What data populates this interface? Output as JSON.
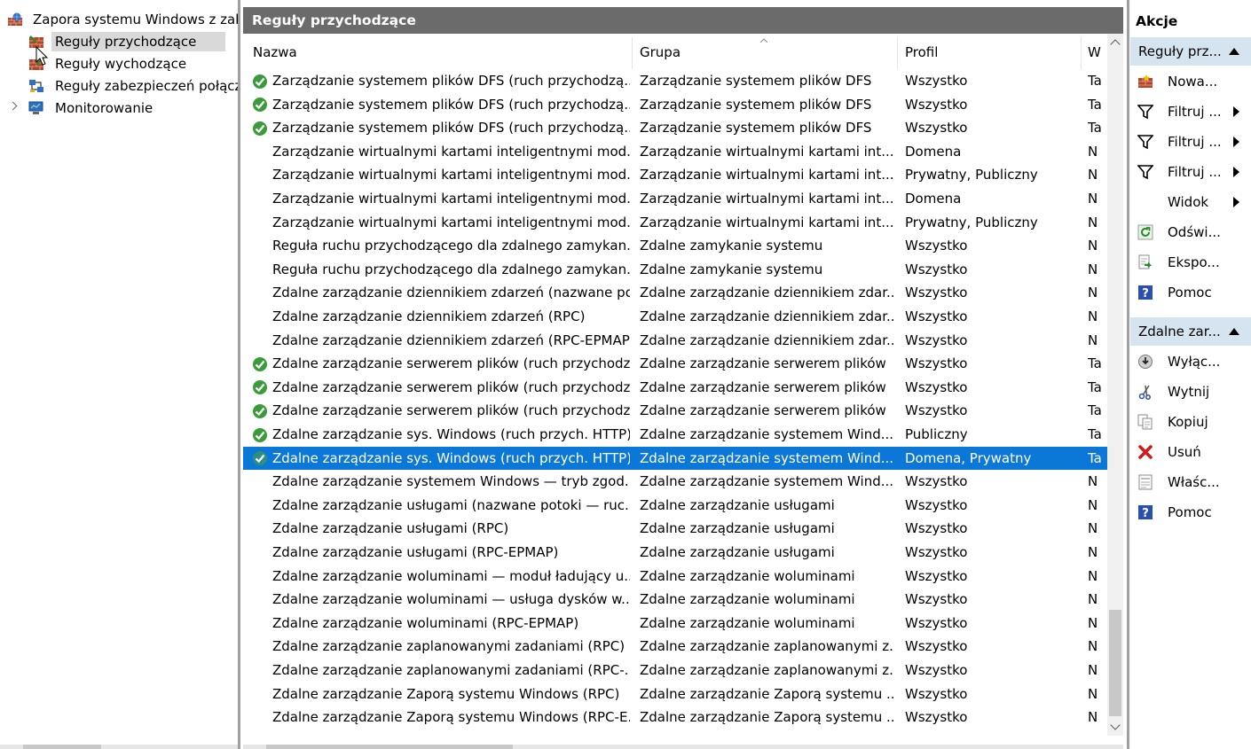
{
  "tree": {
    "root_label": "Zapora systemu Windows z zab",
    "items": [
      {
        "label": "Reguły przychodzące"
      },
      {
        "label": "Reguły wychodzące"
      },
      {
        "label": "Reguły zabezpieczeń połącz"
      },
      {
        "label": "Monitorowanie"
      }
    ]
  },
  "center": {
    "title": "Reguły przychodzące",
    "columns": [
      "Nazwa",
      "Grupa",
      "Profil",
      "W"
    ],
    "rows": [
      {
        "enabled": true,
        "name": "Zarządzanie systemem plików DFS (ruch przychodzą...",
        "group": "Zarządzanie systemem plików DFS",
        "profile": "Wszystko",
        "w": "Ta"
      },
      {
        "enabled": true,
        "name": "Zarządzanie systemem plików DFS (ruch przychodzą...",
        "group": "Zarządzanie systemem plików DFS",
        "profile": "Wszystko",
        "w": "Ta"
      },
      {
        "enabled": true,
        "name": "Zarządzanie systemem plików DFS (ruch przychodzą...",
        "group": "Zarządzanie systemem plików DFS",
        "profile": "Wszystko",
        "w": "Ta"
      },
      {
        "enabled": false,
        "name": "Zarządzanie wirtualnymi kartami inteligentnymi mod...",
        "group": "Zarządzanie wirtualnymi kartami int...",
        "profile": "Domena",
        "w": "N"
      },
      {
        "enabled": false,
        "name": "Zarządzanie wirtualnymi kartami inteligentnymi mod...",
        "group": "Zarządzanie wirtualnymi kartami int...",
        "profile": "Prywatny, Publiczny",
        "w": "N"
      },
      {
        "enabled": false,
        "name": "Zarządzanie wirtualnymi kartami inteligentnymi mod...",
        "group": "Zarządzanie wirtualnymi kartami int...",
        "profile": "Domena",
        "w": "N"
      },
      {
        "enabled": false,
        "name": "Zarządzanie wirtualnymi kartami inteligentnymi mod...",
        "group": "Zarządzanie wirtualnymi kartami int...",
        "profile": "Prywatny, Publiczny",
        "w": "N"
      },
      {
        "enabled": false,
        "name": "Reguła ruchu przychodzącego dla zdalnego zamykan...",
        "group": "Zdalne zamykanie systemu",
        "profile": "Wszystko",
        "w": "N"
      },
      {
        "enabled": false,
        "name": "Reguła ruchu przychodzącego dla zdalnego zamykan...",
        "group": "Zdalne zamykanie systemu",
        "profile": "Wszystko",
        "w": "N"
      },
      {
        "enabled": false,
        "name": "Zdalne zarządzanie dziennikiem zdarzeń (nazwane po...",
        "group": "Zdalne zarządzanie dziennikiem zdar...",
        "profile": "Wszystko",
        "w": "N"
      },
      {
        "enabled": false,
        "name": "Zdalne zarządzanie dziennikiem zdarzeń (RPC)",
        "group": "Zdalne zarządzanie dziennikiem zdar...",
        "profile": "Wszystko",
        "w": "N"
      },
      {
        "enabled": false,
        "name": "Zdalne zarządzanie dziennikiem zdarzeń (RPC-EPMAP)",
        "group": "Zdalne zarządzanie dziennikiem zdar...",
        "profile": "Wszystko",
        "w": "N"
      },
      {
        "enabled": true,
        "name": "Zdalne zarządzanie serwerem plików (ruch przychodz...",
        "group": "Zdalne zarządzanie serwerem plików",
        "profile": "Wszystko",
        "w": "Ta"
      },
      {
        "enabled": true,
        "name": "Zdalne zarządzanie serwerem plików (ruch przychodz...",
        "group": "Zdalne zarządzanie serwerem plików",
        "profile": "Wszystko",
        "w": "Ta"
      },
      {
        "enabled": true,
        "name": "Zdalne zarządzanie serwerem plików (ruch przychodz...",
        "group": "Zdalne zarządzanie serwerem plików",
        "profile": "Wszystko",
        "w": "Ta"
      },
      {
        "enabled": true,
        "name": "Zdalne zarządzanie sys. Windows (ruch przych. HTTP)",
        "group": "Zdalne zarządzanie systemem Wind...",
        "profile": "Publiczny",
        "w": "Ta"
      },
      {
        "enabled": true,
        "selected": true,
        "name": "Zdalne zarządzanie sys. Windows (ruch przych. HTTP)",
        "group": "Zdalne zarządzanie systemem Wind...",
        "profile": "Domena, Prywatny",
        "w": "Ta"
      },
      {
        "enabled": false,
        "name": "Zdalne zarządzanie systemem Windows — tryb zgod...",
        "group": "Zdalne zarządzanie systemem Wind...",
        "profile": "Wszystko",
        "w": "N"
      },
      {
        "enabled": false,
        "name": "Zdalne zarządzanie usługami (nazwane potoki — ruc...",
        "group": "Zdalne zarządzanie usługami",
        "profile": "Wszystko",
        "w": "N"
      },
      {
        "enabled": false,
        "name": "Zdalne zarządzanie usługami (RPC)",
        "group": "Zdalne zarządzanie usługami",
        "profile": "Wszystko",
        "w": "N"
      },
      {
        "enabled": false,
        "name": "Zdalne zarządzanie usługami (RPC-EPMAP)",
        "group": "Zdalne zarządzanie usługami",
        "profile": "Wszystko",
        "w": "N"
      },
      {
        "enabled": false,
        "name": "Zdalne zarządzanie woluminami — moduł ładujący u...",
        "group": "Zdalne zarządzanie woluminami",
        "profile": "Wszystko",
        "w": "N"
      },
      {
        "enabled": false,
        "name": "Zdalne zarządzanie woluminami — usługa dysków w...",
        "group": "Zdalne zarządzanie woluminami",
        "profile": "Wszystko",
        "w": "N"
      },
      {
        "enabled": false,
        "name": "Zdalne zarządzanie woluminami (RPC-EPMAP)",
        "group": "Zdalne zarządzanie woluminami",
        "profile": "Wszystko",
        "w": "N"
      },
      {
        "enabled": false,
        "name": "Zdalne zarządzanie zaplanowanymi zadaniami (RPC)",
        "group": "Zdalne zarządzanie zaplanowanymi z...",
        "profile": "Wszystko",
        "w": "N"
      },
      {
        "enabled": false,
        "name": "Zdalne zarządzanie zaplanowanymi zadaniami (RPC-...",
        "group": "Zdalne zarządzanie zaplanowanymi z...",
        "profile": "Wszystko",
        "w": "N"
      },
      {
        "enabled": false,
        "name": "Zdalne zarządzanie Zaporą systemu Windows (RPC)",
        "group": "Zdalne zarządzanie Zaporą systemu ...",
        "profile": "Wszystko",
        "w": "N"
      },
      {
        "enabled": false,
        "name": "Zdalne zarządzanie Zaporą systemu Windows (RPC-E...",
        "group": "Zdalne zarządzanie Zaporą systemu ...",
        "profile": "Wszystko",
        "w": "N"
      }
    ]
  },
  "actions": {
    "title": "Akcje",
    "section1": {
      "label": "Reguły prz...",
      "items": [
        {
          "label": "Nowa...",
          "icon": "new-rule-icon",
          "submenu": false
        },
        {
          "label": "Filtruj ...",
          "icon": "filter-icon",
          "submenu": true
        },
        {
          "label": "Filtruj ...",
          "icon": "filter-icon",
          "submenu": true
        },
        {
          "label": "Filtruj ...",
          "icon": "filter-icon",
          "submenu": true
        },
        {
          "label": "Widok",
          "icon": "",
          "submenu": true
        },
        {
          "label": "Odświ...",
          "icon": "refresh-icon",
          "submenu": false
        },
        {
          "label": "Ekspo...",
          "icon": "export-icon",
          "submenu": false
        },
        {
          "label": "Pomoc",
          "icon": "help-icon",
          "submenu": false
        }
      ]
    },
    "section2": {
      "label": "Zdalne zar...",
      "items": [
        {
          "label": "Wyłąc...",
          "icon": "disable-icon",
          "submenu": false
        },
        {
          "label": "Wytnij",
          "icon": "cut-icon",
          "submenu": false
        },
        {
          "label": "Kopiuj",
          "icon": "copy-icon",
          "submenu": false
        },
        {
          "label": "Usuń",
          "icon": "delete-icon",
          "submenu": false
        },
        {
          "label": "Właśc...",
          "icon": "properties-icon",
          "submenu": false
        },
        {
          "label": "Pomoc",
          "icon": "help-icon",
          "submenu": false
        }
      ]
    }
  },
  "colors": {
    "title_bar": "#6b6b6b",
    "selection": "#0b78d7",
    "action_section": "#d6e4f0",
    "enabled_check": "#3a9b3a"
  }
}
